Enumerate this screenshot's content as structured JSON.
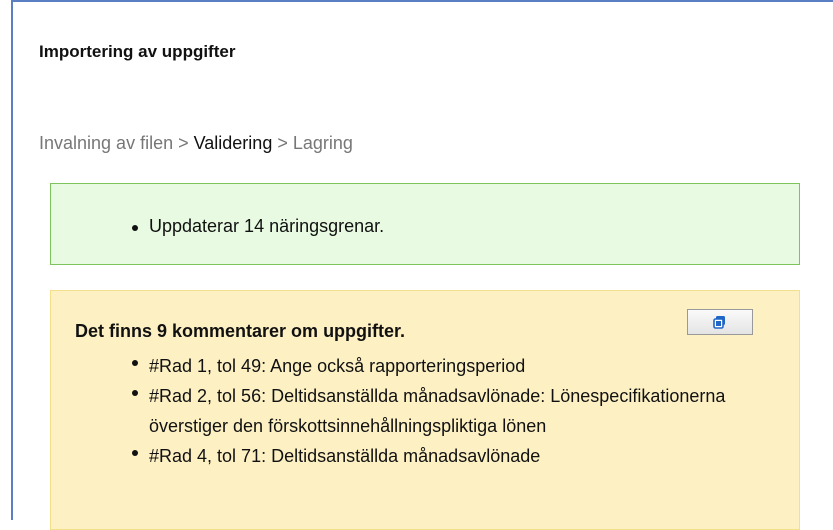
{
  "page": {
    "title": "Importering av uppgifter"
  },
  "breadcrumb": {
    "step1": "Invalning av filen",
    "sep1": " > ",
    "step2": "Validering",
    "sep2": " > ",
    "step3": "Lagring"
  },
  "success": {
    "items": [
      "Uppdaterar 14 näringsgrenar."
    ]
  },
  "comments": {
    "title": "Det finns 9 kommentarer om uppgifter.",
    "copy_icon": "copy-icon",
    "items": [
      "#Rad 1, tol 49: Ange också rapporteringsperiod",
      "#Rad 2, tol 56: Deltidsanställda månadsavlönade: Lönespecifikationerna överstiger den förskottsinnehållningspliktiga lönen",
      "#Rad 4, tol 71: Deltidsanställda månadsavlönade"
    ]
  },
  "colors": {
    "success_bg": "#e8fbe2",
    "success_border": "#7cc45b",
    "warning_bg": "#fdf1c4",
    "warning_border": "#f3e08a",
    "panel_border": "#5b7fc2"
  }
}
